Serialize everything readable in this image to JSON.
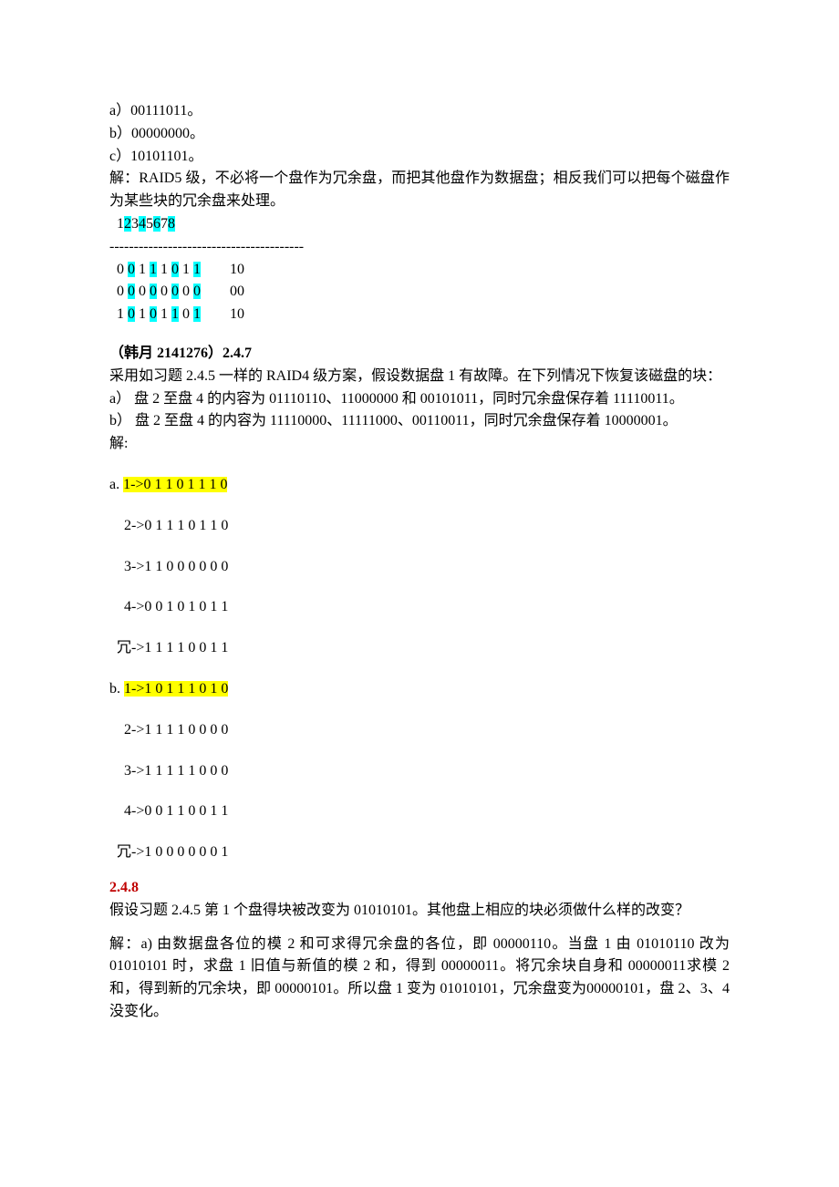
{
  "top": {
    "a": "a）00111011。",
    "b": "b）00000000。",
    "c": "c）10101101。",
    "explain": "解：RAID5 级，不必将一个盘作为冗余盘，而把其他盘作为数据盘；相反我们可以把每个磁盘作为某些块的冗余盘来处理。",
    "header": {
      "p1": "  1",
      "h2": "2",
      "p3": "3",
      "h4": "4",
      "p5": "5",
      "h6": "6",
      "p7": "7",
      "h8": "8"
    },
    "dashes": "----------------------------------------",
    "row1": {
      "c0": "  0 ",
      "c1": "0",
      "c2": " 1 ",
      "c3": "1",
      "c4": " 1 ",
      "c5": "0",
      "c6": " 1 ",
      "c7": "1",
      "tail": "        10"
    },
    "row2": {
      "c0": "  0 ",
      "c1": "0",
      "c2": " 0 ",
      "c3": "0",
      "c4": " 0 ",
      "c5": "0",
      "c6": " 0 ",
      "c7": "0",
      "tail": "        00"
    },
    "row3": {
      "c0": "  1 ",
      "c1": "0",
      "c2": " 1 ",
      "c3": "0",
      "c4": " 1 ",
      "c5": "1",
      "c6": " 0 ",
      "c7": "1",
      "tail": "        10"
    }
  },
  "s247": {
    "title_left": "（韩月  2141276）",
    "title_num": "2.4.7",
    "desc": "采用如习题 2.4.5 一样的 RAID4 级方案，假设数据盘 1 有故障。在下列情况下恢复该磁盘的块：",
    "qa": "a） 盘 2 至盘 4 的内容为 01110110、11000000 和 00101011，同时冗余盘保存着 11110011。",
    "qb": "b） 盘 2 至盘 4 的内容为 11110000、11111000、00110011，同时冗余盘保存着 10000001。",
    "jie": "解:",
    "a_label": "a. ",
    "a_hl": "1->0 1 1 0 1 1 1 0",
    "a2": "    2->0 1 1 1 0 1 1 0",
    "a3": "    3->1 1 0 0 0 0 0 0",
    "a4": "    4->0 0 1 0 1 0 1 1",
    "ar": "  冗->1 1 1 1 0 0 1 1",
    "b_label": "b. ",
    "b_hl": "1->1 0 1 1 1 0 1 0",
    "b2": "    2->1 1 1 1 0 0 0 0",
    "b3": "    3->1 1 1 1 1 0 0 0",
    "b4": "    4->0 0 1 1 0 0 1 1",
    "br": "  冗->1 0 0 0 0 0 0 1"
  },
  "s248": {
    "title": "2.4.8",
    "q": "假设习题 2.4.5 第 1 个盘得块被改变为 01010101。其他盘上相应的块必须做什么样的改变？",
    "ans": "解：a)  由数据盘各位的模 2 和可求得冗余盘的各位，即 00000110。当盘 1 由 01010110 改为 01010101 时，求盘 1 旧值与新值的模 2 和，得到 00000011。将冗余块自身和 00000011求模 2 和，得到新的冗余块，即 00000101。所以盘 1 变为 01010101，冗余盘变为00000101，盘 2、3、4 没变化。"
  }
}
